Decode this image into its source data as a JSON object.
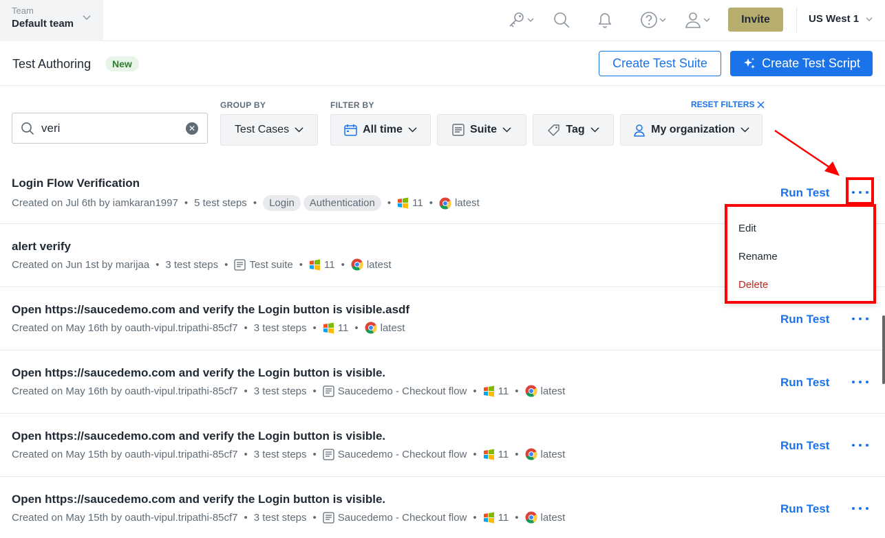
{
  "topbar": {
    "team_label": "Team",
    "team_name": "Default team",
    "invite_label": "Invite",
    "region": "US West 1"
  },
  "header": {
    "title": "Test Authoring",
    "badge": "New",
    "create_suite": "Create Test Suite",
    "create_script": "Create Test Script"
  },
  "filters": {
    "search_value": "veri",
    "group_by_label": "GROUP BY",
    "filter_by_label": "FILTER BY",
    "reset_label": "RESET FILTERS",
    "group_by_value": "Test Cases",
    "time": "All time",
    "suite": "Suite",
    "tag": "Tag",
    "org": "My organization"
  },
  "list": {
    "run_label": "Run Test",
    "rows": [
      {
        "title": "Login Flow Verification",
        "created": "Created on Jul 6th by iamkaran1997",
        "steps": "5 test steps",
        "tags": [
          "Login",
          "Authentication"
        ],
        "os": "11",
        "browser": "latest"
      },
      {
        "title": "alert verify",
        "created": "Created on Jun 1st by marijaa",
        "steps": "3 test steps",
        "suite": "Test suite",
        "os": "11",
        "browser": "latest"
      },
      {
        "title": "Open https://saucedemo.com and verify the Login button is visible.asdf",
        "created": "Created on May 16th by oauth-vipul.tripathi-85cf7",
        "steps": "3 test steps",
        "os": "11",
        "browser": "latest"
      },
      {
        "title": "Open https://saucedemo.com and verify the Login button is visible.",
        "created": "Created on May 16th by oauth-vipul.tripathi-85cf7",
        "steps": "3 test steps",
        "suite": "Saucedemo - Checkout flow",
        "os": "11",
        "browser": "latest"
      },
      {
        "title": "Open https://saucedemo.com and verify the Login button is visible.",
        "created": "Created on May 15th by oauth-vipul.tripathi-85cf7",
        "steps": "3 test steps",
        "suite": "Saucedemo - Checkout flow",
        "os": "11",
        "browser": "latest"
      },
      {
        "title": "Open https://saucedemo.com and verify the Login button is visible.",
        "created": "Created on May 15th by oauth-vipul.tripathi-85cf7",
        "steps": "3 test steps",
        "suite": "Saucedemo - Checkout flow",
        "os": "11",
        "browser": "latest"
      }
    ]
  },
  "context_menu": {
    "edit": "Edit",
    "rename": "Rename",
    "delete": "Delete"
  },
  "colors": {
    "accent": "#1a73e8",
    "invite": "#b7ad6e",
    "highlight": "#ff0000",
    "delete": "#c0281b"
  }
}
